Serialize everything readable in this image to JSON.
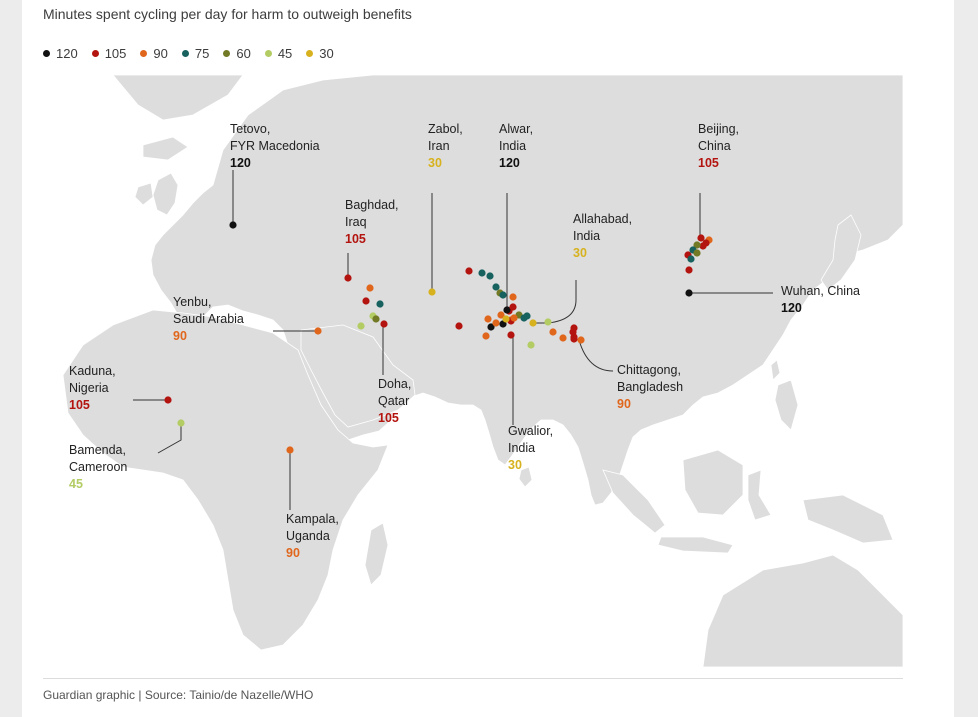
{
  "title": "Minutes spent cycling per day for harm to outweigh benefits",
  "legend": [
    {
      "label": "120",
      "color": "#111111"
    },
    {
      "label": "105",
      "color": "#b3140f"
    },
    {
      "label": "90",
      "color": "#e0661c"
    },
    {
      "label": "75",
      "color": "#17625f"
    },
    {
      "label": "60",
      "color": "#737a25"
    },
    {
      "label": "45",
      "color": "#b3cc63"
    },
    {
      "label": "30",
      "color": "#d7b21e"
    }
  ],
  "labels": [
    {
      "id": "tetovo",
      "line1": "Tetovo,",
      "line2": "FYR Macedonia",
      "value": "120",
      "color": "#111111"
    },
    {
      "id": "zabol",
      "line1": "Zabol,",
      "line2": "Iran",
      "value": "30",
      "color": "#d7b21e"
    },
    {
      "id": "alwar",
      "line1": "Alwar,",
      "line2": "India",
      "value": "120",
      "color": "#111111"
    },
    {
      "id": "beijing",
      "line1": "Beijing,",
      "line2": "China",
      "value": "105",
      "color": "#b3140f"
    },
    {
      "id": "baghdad",
      "line1": "Baghdad,",
      "line2": "Iraq",
      "value": "105",
      "color": "#b3140f"
    },
    {
      "id": "allahabad",
      "line1": "Allahabad,",
      "line2": "India",
      "value": "30",
      "color": "#d7b21e"
    },
    {
      "id": "wuhan",
      "line1": "Wuhan, China",
      "line2": "",
      "value": "120",
      "color": "#111111"
    },
    {
      "id": "yenbu",
      "line1": "Yenbu,",
      "line2": "Saudi Arabia",
      "value": "90",
      "color": "#e0661c"
    },
    {
      "id": "kaduna",
      "line1": "Kaduna,",
      "line2": "Nigeria",
      "value": "105",
      "color": "#b3140f"
    },
    {
      "id": "doha",
      "line1": "Doha,",
      "line2": "Qatar",
      "value": "105",
      "color": "#b3140f"
    },
    {
      "id": "chittagong",
      "line1": "Chittagong,",
      "line2": "Bangladesh",
      "value": "90",
      "color": "#e0661c"
    },
    {
      "id": "gwalior",
      "line1": "Gwalior,",
      "line2": "India",
      "value": "30",
      "color": "#d7b21e"
    },
    {
      "id": "bamenda",
      "line1": "Bamenda,",
      "line2": "Cameroon",
      "value": "45",
      "color": "#b3cc63"
    },
    {
      "id": "kampala",
      "line1": "Kampala,",
      "line2": "Uganda",
      "value": "90",
      "color": "#e0661c"
    }
  ],
  "source": "Guardian graphic | Source: Tainio/de Nazelle/WHO"
}
